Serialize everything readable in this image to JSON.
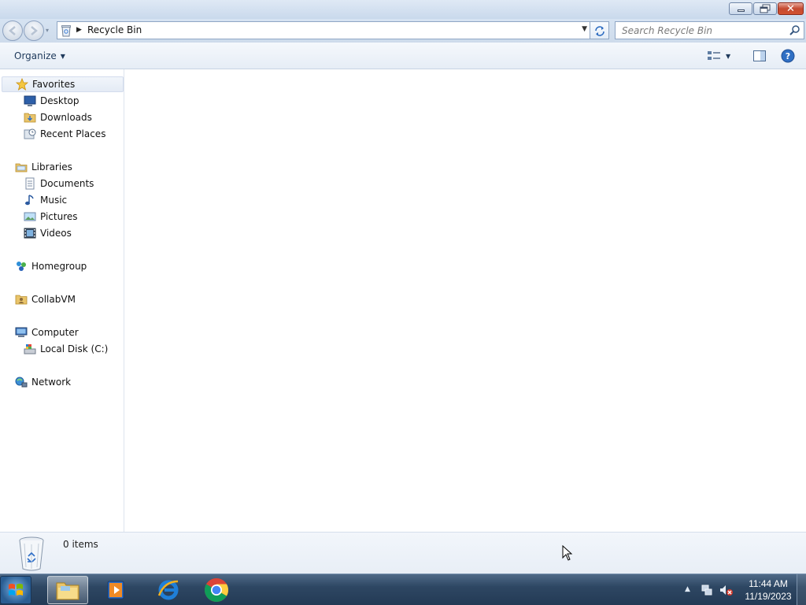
{
  "window": {
    "caption_buttons": [
      "minimize",
      "restore",
      "close"
    ]
  },
  "address_bar": {
    "location": "Recycle Bin",
    "search_placeholder": "Search Recycle Bin"
  },
  "command_bar": {
    "organize_label": "Organize"
  },
  "nav_pane": {
    "favorites": {
      "label": "Favorites",
      "items": [
        {
          "label": "Desktop",
          "icon": "desktop-icon"
        },
        {
          "label": "Downloads",
          "icon": "downloads-icon"
        },
        {
          "label": "Recent Places",
          "icon": "recent-places-icon"
        }
      ]
    },
    "libraries": {
      "label": "Libraries",
      "items": [
        {
          "label": "Documents",
          "icon": "documents-icon"
        },
        {
          "label": "Music",
          "icon": "music-icon"
        },
        {
          "label": "Pictures",
          "icon": "pictures-icon"
        },
        {
          "label": "Videos",
          "icon": "videos-icon"
        }
      ]
    },
    "homegroup": {
      "label": "Homegroup"
    },
    "user": {
      "label": "CollabVM"
    },
    "computer": {
      "label": "Computer",
      "items": [
        {
          "label": "Local Disk (C:)",
          "icon": "drive-icon"
        }
      ]
    },
    "network": {
      "label": "Network"
    }
  },
  "details_pane": {
    "item_count": "0 items"
  },
  "taskbar": {
    "pinned": [
      "windows-explorer",
      "windows-media-player",
      "internet-explorer",
      "google-chrome"
    ],
    "clock": {
      "time": "11:44 AM",
      "date": "11/19/2023"
    }
  },
  "colors": {
    "accent": "#1e395b",
    "selection": "#e4ebf5",
    "taskbar": "#2e4763"
  }
}
